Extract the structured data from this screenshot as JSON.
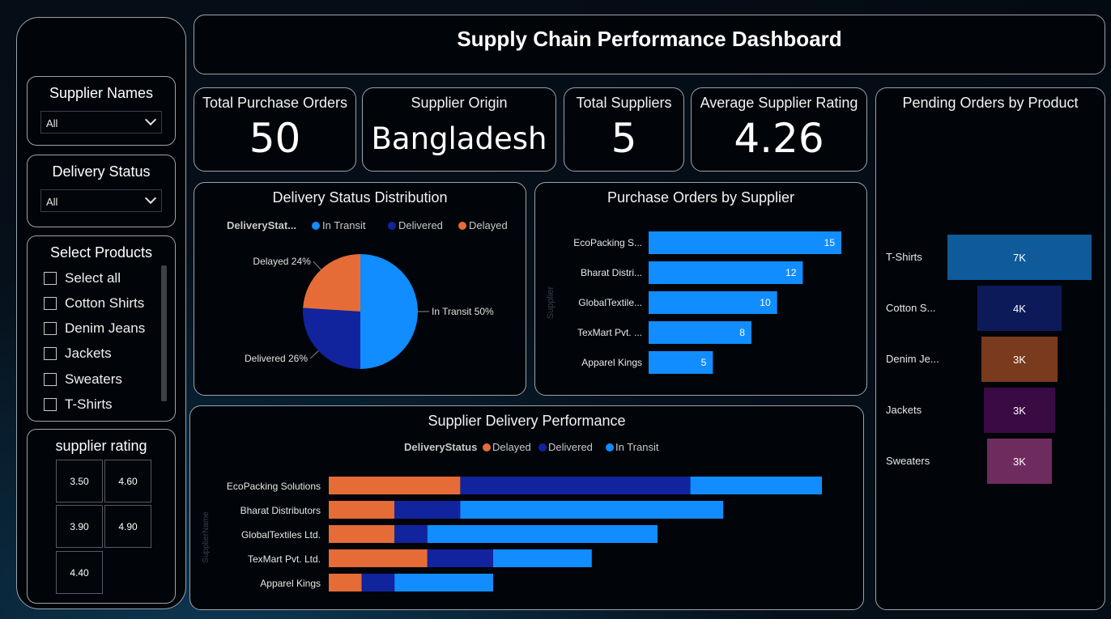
{
  "header": {
    "title": "Supply Chain Performance Dashboard"
  },
  "sidebar": {
    "supplier_names": {
      "title": "Supplier Names",
      "selected": "All"
    },
    "delivery_status": {
      "title": "Delivery Status",
      "selected": "All"
    },
    "products": {
      "title": "Select Products",
      "items": [
        "Select all",
        "Cotton Shirts",
        "Denim Jeans",
        "Jackets",
        "Sweaters",
        "T-Shirts"
      ]
    },
    "rating": {
      "title": "supplier rating",
      "tiles": [
        "3.50",
        "4.60",
        "3.90",
        "4.90",
        "4.40"
      ]
    }
  },
  "kpis": [
    {
      "label": "Total Purchase Orders",
      "value": "50"
    },
    {
      "label": "Supplier Origin",
      "value": "Bangladesh"
    },
    {
      "label": "Total Suppliers",
      "value": "5"
    },
    {
      "label": "Average Supplier Rating",
      "value": "4.26"
    }
  ],
  "colors": {
    "in_transit": "#118dff",
    "delivered": "#12239e",
    "delayed": "#e66c37",
    "funnel": [
      "#0e5a9a",
      "#0c1a5a",
      "#7a3a1e",
      "#3a0a44",
      "#6e2c5e"
    ]
  },
  "chart_data": [
    {
      "type": "pie",
      "title": "Delivery Status Distribution",
      "legend_title": "DeliveryStat...",
      "legend_position": "top",
      "slices": [
        {
          "name": "In Transit",
          "value": 50,
          "label": "In Transit 50%"
        },
        {
          "name": "Delivered",
          "value": 26,
          "label": "Delivered 26%"
        },
        {
          "name": "Delayed",
          "value": 24,
          "label": "Delayed 24%"
        }
      ]
    },
    {
      "type": "bar",
      "orientation": "horizontal",
      "title": "Purchase Orders by Supplier",
      "ylabel": "Supplier",
      "categories": [
        "EcoPacking S...",
        "Bharat Distri...",
        "GlobalTextile...",
        "TexMart Pvt. ...",
        "Apparel Kings"
      ],
      "values": [
        15,
        12,
        10,
        8,
        5
      ]
    },
    {
      "type": "bar",
      "orientation": "horizontal",
      "stacked": true,
      "title": "Supplier Delivery Performance",
      "legend_title": "DeliveryStatus",
      "legend_position": "top",
      "ylabel": "SupplierName",
      "categories": [
        "EcoPacking Solutions",
        "Bharat Distributors",
        "GlobalTextiles Ltd.",
        "TexMart Pvt. Ltd.",
        "Apparel Kings"
      ],
      "series": [
        {
          "name": "Delayed",
          "values": [
            4,
            2,
            2,
            3,
            1
          ]
        },
        {
          "name": "Delivered",
          "values": [
            7,
            2,
            1,
            2,
            1
          ]
        },
        {
          "name": "In Transit",
          "values": [
            4,
            8,
            7,
            3,
            3
          ]
        }
      ]
    },
    {
      "type": "bar",
      "orientation": "funnel",
      "title": "Pending Orders by Product",
      "categories": [
        "T-Shirts",
        "Cotton S...",
        "Denim Je...",
        "Jackets",
        "Sweaters"
      ],
      "values": [
        7000,
        4000,
        3000,
        3000,
        3000
      ],
      "labels": [
        "7K",
        "4K",
        "3K",
        "3K",
        "3K"
      ]
    }
  ]
}
